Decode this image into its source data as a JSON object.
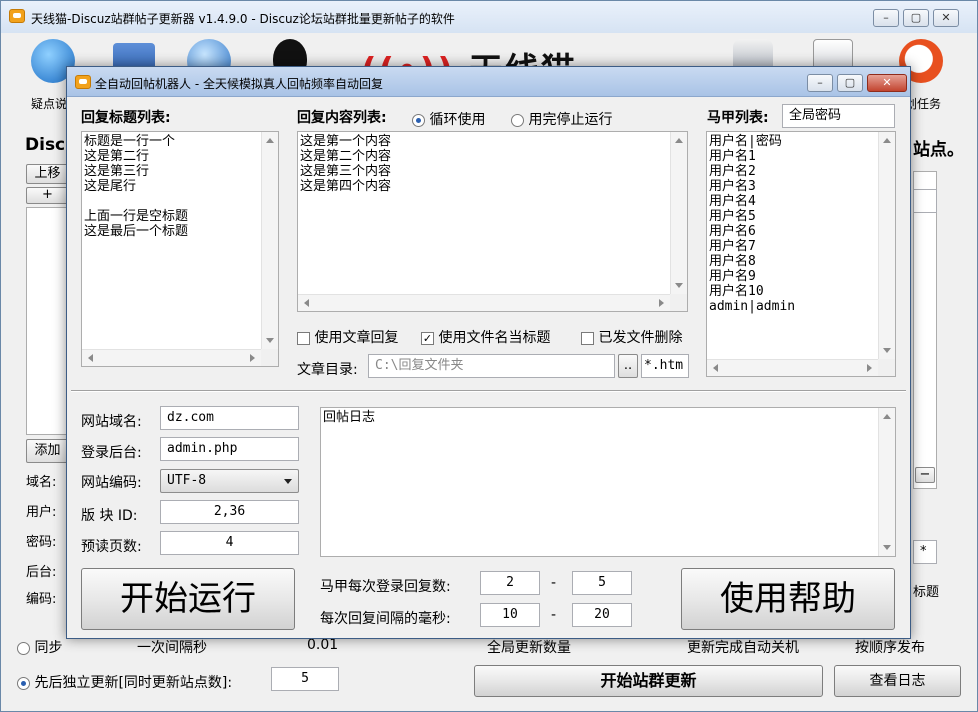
{
  "main": {
    "title": "天线猫-Discuz站群帖子更新器 v1.4.9.0 - Discuz论坛站群批量更新帖子的软件",
    "toolbar": {
      "left_label": "疑点说",
      "right_label": "划任务",
      "brand": "天线猫"
    },
    "left_heading": "Disc",
    "right_heading": "站点。",
    "btn_up": "上移",
    "btn_plus": "+",
    "btn_add": "添加",
    "btn_minus": "−",
    "labels": {
      "domain": "域名:",
      "user": "用户:",
      "password": "密码:",
      "backend": "后台:",
      "encoding": "编码:"
    },
    "right_star": "*",
    "right_title_cut": "标题",
    "bottom": {
      "sync_text": "同步",
      "sync_cut_text": "一次间隔秒",
      "sync_cut_value": "0.01",
      "global_cut": "全局更新数量",
      "update_cut": "更新完成自动关机",
      "order_cut": "按顺序发布",
      "independent_text": "先后独立更新[同时更新站点数]:",
      "independent_value": "5",
      "start_btn": "开始站群更新",
      "log_btn": "查看日志"
    }
  },
  "dialog": {
    "title": "全自动回帖机器人 - 全天候模拟真人回帖频率自动回复",
    "title_list_label": "回复标题列表:",
    "title_list": [
      "标题是一行一个",
      "这是第二行",
      "这是第三行",
      "这是尾行",
      "",
      "上面一行是空标题",
      "这是最后一个标题"
    ],
    "content_list_label": "回复内容列表:",
    "loop_option": "循环使用",
    "stop_option": "用完停止运行",
    "content_list": [
      "这是第一个内容",
      "这是第二个内容",
      "这是第三个内容",
      "这是第四个内容"
    ],
    "accounts_label": "马甲列表:",
    "accounts_value": "全局密码",
    "accounts": [
      "用户名|密码",
      "用户名1",
      "用户名2",
      "用户名3",
      "用户名4",
      "用户名5",
      "用户名6",
      "用户名7",
      "用户名8",
      "用户名9",
      "用户名10",
      "admin|admin"
    ],
    "opt_article_reply": "使用文章回复",
    "opt_filename_title": "使用文件名当标题",
    "opt_delete_sent": "已发文件删除",
    "dir_label": "文章目录:",
    "dir_placeholder": "C:\\回复文件夹",
    "dir_browse": "..",
    "dir_ext": "*.htm",
    "site_domain_label": "网站域名:",
    "site_domain": "dz.com",
    "login_label": "登录后台:",
    "login_value": "admin.php",
    "encoding_label": "网站编码:",
    "encoding_value": "UTF-8",
    "forum_id_label": "版 块 ID:",
    "forum_id": "2,36",
    "pages_label": "预读页数:",
    "pages": "4",
    "log_text": "回帖日志",
    "start_btn": "开始运行",
    "help_btn": "使用帮助",
    "replies_label": "马甲每次登录回复数:",
    "replies_min": "2",
    "replies_max": "5",
    "interval_label": "每次回复间隔的毫秒:",
    "interval_min": "10",
    "interval_max": "20",
    "dash": "-"
  }
}
